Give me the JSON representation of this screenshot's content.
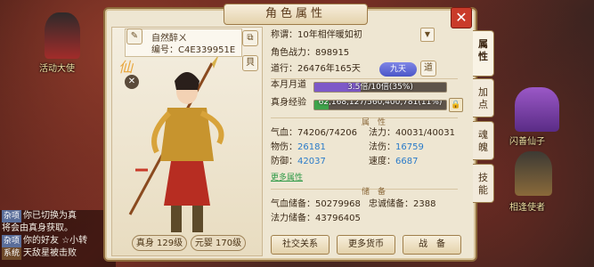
{
  "window_title": "角色属性",
  "npcs": [
    {
      "label": "活动大使"
    },
    {
      "label": "闪善仙子"
    },
    {
      "label": "相逢使者"
    }
  ],
  "chat": [
    {
      "tag": "杂项",
      "text": "你已切换为真"
    },
    {
      "tag": "",
      "text": "将会由真身获取。"
    },
    {
      "tag": "杂项",
      "text": "你的好友 ☆小转"
    },
    {
      "tag": "系统",
      "text": "天敌星被击败"
    }
  ],
  "character": {
    "name": "自然醉ㄨ",
    "id_label": "编号：",
    "id": "C4E339951E",
    "badge_text": "仙",
    "gender_icon": "male-gender-icon",
    "true_body_label": "真身",
    "true_body_level": "129级",
    "spirit_label": "元婴",
    "spirit_level": "170级"
  },
  "info": {
    "title_label": "称谓：",
    "title_value": "10年相伴暖如初",
    "power_label": "角色战力：",
    "power_value": "898915",
    "dao_label": "道行：",
    "dao_value": "26476年165天",
    "dao_badge": "九天",
    "dao_button": "道",
    "monthly_label": "本月月道",
    "monthly_text": "3.5倍/10倍(35%)",
    "monthly_percent": 35,
    "exp_label": "真身经验",
    "exp_text": "62,168,127/560,400,781(11%)",
    "exp_percent": 11,
    "attr_section": "属　性",
    "qixue_label": "气血：",
    "qixue_value": "74206/74206",
    "fali_label": "法力：",
    "fali_value": "40031/40031",
    "wushang_label": "物伤：",
    "wushang_value": "26181",
    "fashang_label": "法伤：",
    "fashang_value": "16759",
    "fangyu_label": "防御：",
    "fangyu_value": "42037",
    "sudu_label": "速度：",
    "sudu_value": "6687",
    "more_attr": "更多属性",
    "store_section": "储　备",
    "qixue_store_label": "气血储备：",
    "qixue_store_value": "50279968",
    "zhongcheng_label": "忠诚储备：",
    "zhongcheng_value": "2388",
    "fali_store_label": "法力储备：",
    "fali_store_value": "43796405"
  },
  "buttons": {
    "social": "社交关系",
    "currency": "更多货币",
    "battle": "战　备"
  },
  "tabs": [
    {
      "label": "属\n性",
      "active": true
    },
    {
      "label": "加\n点",
      "active": false
    },
    {
      "label": "魂\n魄",
      "active": false
    },
    {
      "label": "技\n能",
      "active": false
    }
  ],
  "colors": {
    "accent": "#c93b2a",
    "blue_value": "#2a7bc9",
    "green": "#2f9a47"
  }
}
